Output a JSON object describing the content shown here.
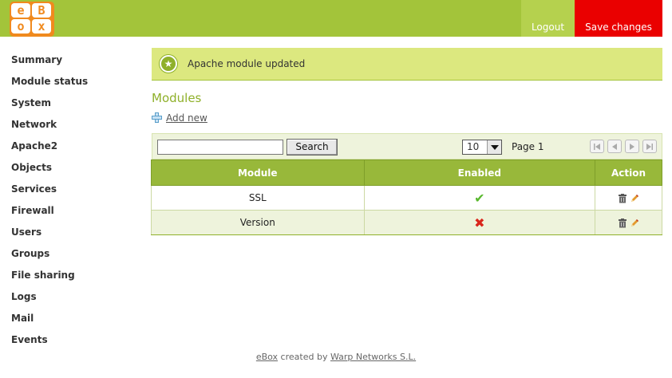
{
  "header": {
    "logo_letters": [
      "e",
      "B",
      "o",
      "x"
    ],
    "logout_label": "Logout",
    "save_label": "Save changes",
    "colors": {
      "bar": "#a3c43a",
      "save": "#ea0000",
      "logo": "#f08a1e"
    }
  },
  "sidebar": {
    "items": [
      {
        "label": "Summary"
      },
      {
        "label": "Module status"
      },
      {
        "label": "System"
      },
      {
        "label": "Network"
      },
      {
        "label": "Apache2"
      },
      {
        "label": "Objects"
      },
      {
        "label": "Services"
      },
      {
        "label": "Firewall"
      },
      {
        "label": "Users"
      },
      {
        "label": "Groups"
      },
      {
        "label": "File sharing"
      },
      {
        "label": "Logs"
      },
      {
        "label": "Mail"
      },
      {
        "label": "Events"
      }
    ]
  },
  "notice": {
    "icon": "success-star-icon",
    "text": "Apache module updated"
  },
  "main": {
    "title": "Modules",
    "add_new_label": "Add new",
    "search": {
      "value": "",
      "button_label": "Search"
    },
    "pagination": {
      "rows_per_page": "10",
      "page_label": "Page 1"
    },
    "table": {
      "columns": [
        "Module",
        "Enabled",
        "Action"
      ],
      "rows": [
        {
          "module": "SSL",
          "enabled": "check-icon",
          "enabled_mark": "✔"
        },
        {
          "module": "Version",
          "enabled": "cross-icon",
          "enabled_mark": "✖"
        }
      ]
    }
  },
  "footer": {
    "product": "eBox",
    "created_by": " created by ",
    "company": "Warp Networks S.L."
  }
}
